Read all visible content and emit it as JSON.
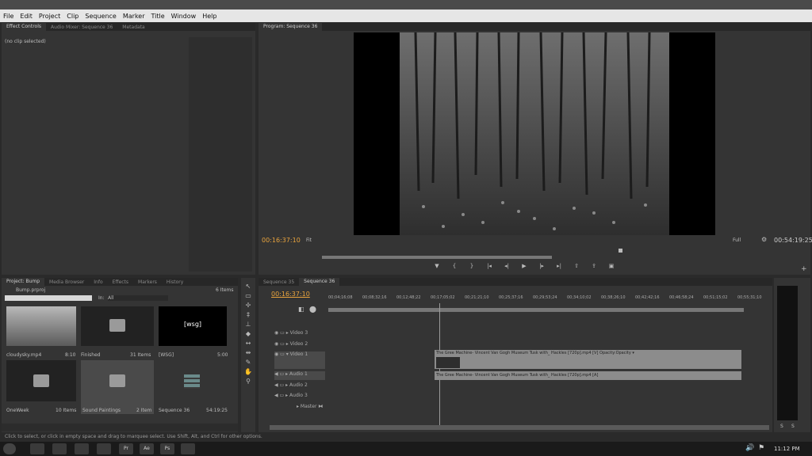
{
  "menu": [
    "File",
    "Edit",
    "Project",
    "Clip",
    "Sequence",
    "Marker",
    "Title",
    "Window",
    "Help"
  ],
  "effect_controls": {
    "tabs": [
      "Effect Controls",
      "Audio Mixer: Sequence 36",
      "Metadata"
    ],
    "no_clip": "(no clip selected)"
  },
  "program": {
    "tab": "Program: Sequence 36",
    "timecode_left": "00:16:37:10",
    "fit": "Fit",
    "full": "Full",
    "timecode_right": "00:54:19:25",
    "transport_icons": [
      "marker-icon",
      "mark-in-icon",
      "mark-out-icon",
      "go-to-in-icon",
      "step-back-icon",
      "play-icon",
      "step-forward-icon",
      "go-to-out-icon",
      "lift-icon",
      "extract-icon",
      "export-frame-icon"
    ]
  },
  "project": {
    "tabs": [
      "Project: Bump",
      "Media Browser",
      "Info",
      "Effects",
      "Markers",
      "History"
    ],
    "file": "Bump.prproj",
    "items_count": "6 Items",
    "in_label": "In:",
    "in_value": "All",
    "items": [
      {
        "name": "cloudysky.mp4",
        "meta": "8:10",
        "kind": "clip"
      },
      {
        "name": "Finished",
        "meta": "31 Items",
        "kind": "bin"
      },
      {
        "name": "[WSG]",
        "meta": "5:00",
        "kind": "wsg",
        "label": "[wsg]"
      },
      {
        "name": "OneWeek",
        "meta": "10 Items",
        "kind": "bin"
      },
      {
        "name": "Sound Paintings",
        "meta": "2 Item",
        "kind": "bin"
      },
      {
        "name": "Sequence 36",
        "meta": "54:19:25",
        "kind": "sequence"
      }
    ]
  },
  "timeline": {
    "tabs": [
      "Sequence 35",
      "Sequence 36"
    ],
    "timecode": "00:16:37:10",
    "ruler": [
      "00;04;16;08",
      "00;08;32;16",
      "00;12;48;22",
      "00;17;05;02",
      "00;21;21;10",
      "00;25;37;16",
      "00;29;53;24",
      "00;34;10;02",
      "00;38;26;10",
      "00;42;42;16",
      "00;46;58;24",
      "00;51;15;02",
      "00;55;31;10"
    ],
    "video_tracks": [
      "Video 3",
      "Video 2",
      "Video 1"
    ],
    "audio_tracks": [
      "Audio 1",
      "Audio 2",
      "Audio 3"
    ],
    "master": "Master",
    "video_clip": "The Gree Machine- Vincent Van Gogh Museum Tusk with_ Hackles [720p].mp4 [V] Opacity:Opacity ▾",
    "audio_clip": "The Gree Machine- Vincent Van Gogh Museum Tusk with_ Hackles [720p].mp4 [A]"
  },
  "meter": {
    "labels": [
      "S",
      "S"
    ]
  },
  "status": "Click to select, or click in empty space and drag to marquee select. Use Shift, Alt, and Ctrl for other options.",
  "taskbar": {
    "time": "11:12 PM",
    "apps": [
      "Pr",
      "Ae",
      "Ps"
    ]
  },
  "colors": {
    "accent": "#e8a33d",
    "panel": "#343434",
    "clip": "#8c8c8c"
  }
}
